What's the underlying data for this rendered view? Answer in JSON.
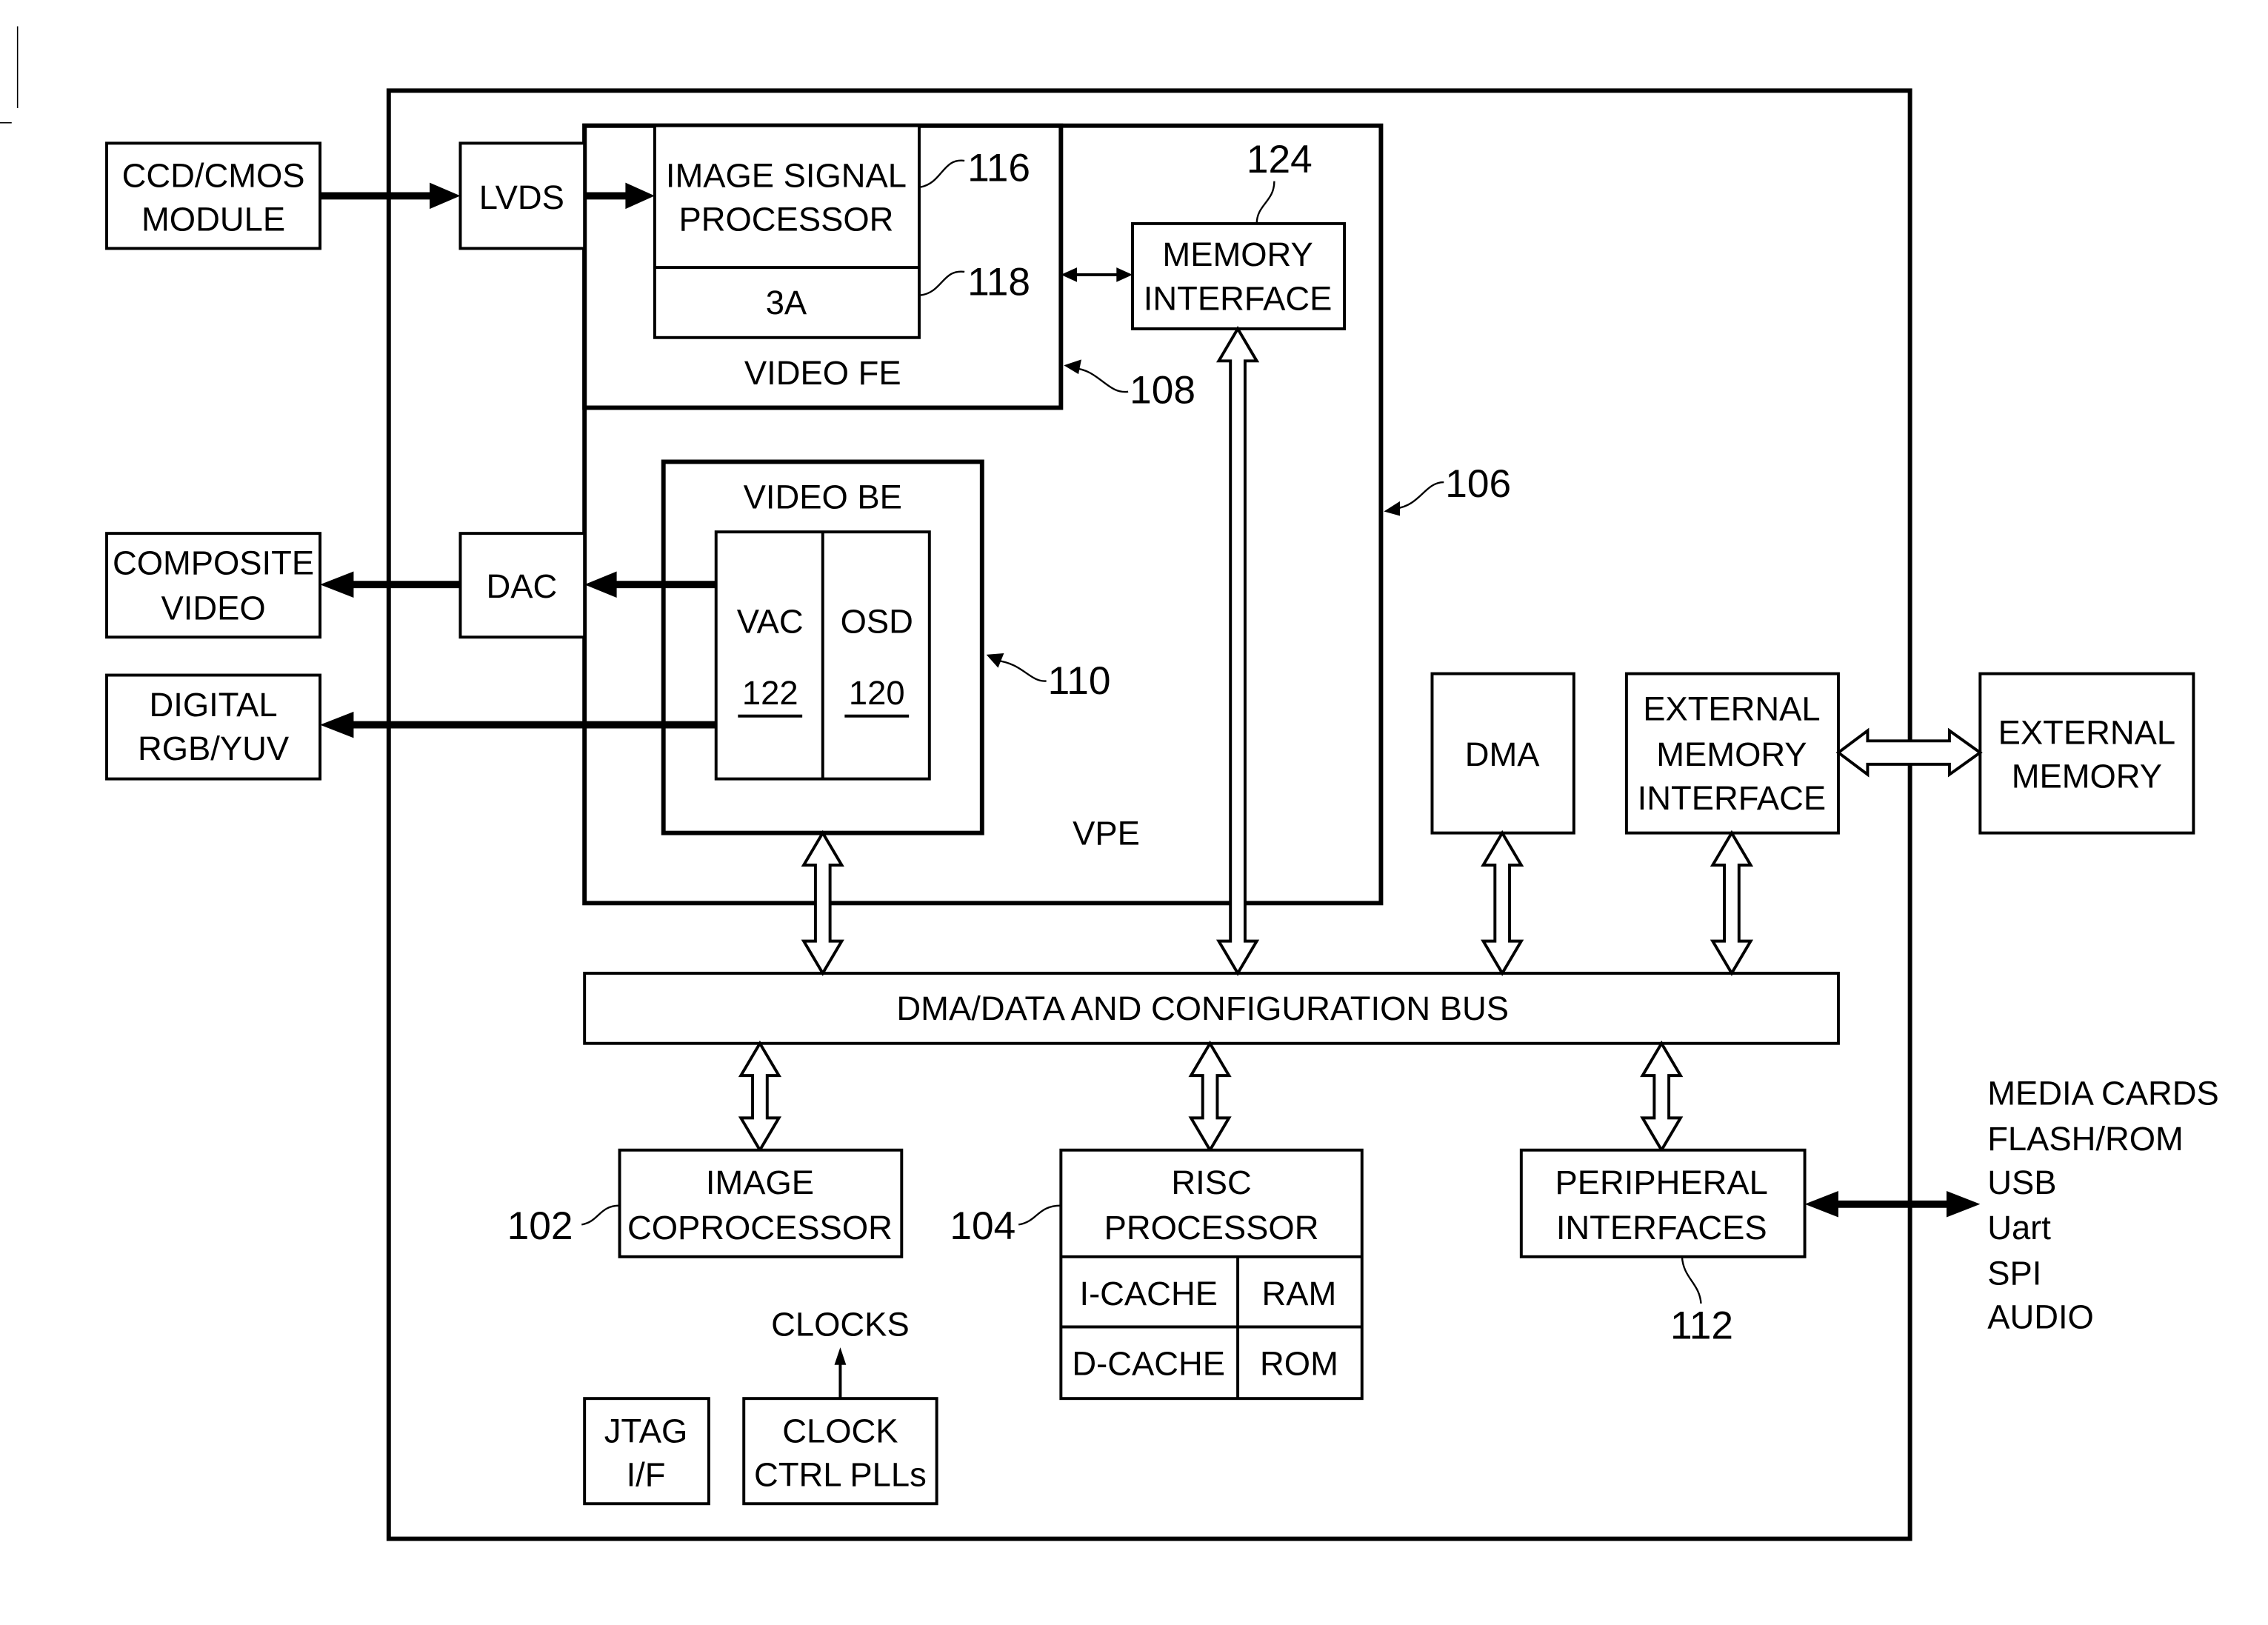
{
  "figure": {
    "external": {
      "ccd_cmos": [
        "CCD/CMOS",
        "MODULE"
      ],
      "composite_video": [
        "COMPOSITE",
        "VIDEO"
      ],
      "digital_rgb": [
        "DIGITAL",
        "RGB/YUV"
      ],
      "external_memory": [
        "EXTERNAL",
        "MEMORY"
      ],
      "media_list": [
        "MEDIA CARDS",
        "FLASH/ROM",
        "USB",
        "Uart",
        "SPI",
        "AUDIO"
      ]
    },
    "soc": {
      "lvds": "LVDS",
      "dac": "DAC",
      "isp": [
        "IMAGE SIGNAL",
        "PROCESSOR"
      ],
      "three_a": "3A",
      "video_fe": "VIDEO FE",
      "memory_interface": [
        "MEMORY",
        "INTERFACE"
      ],
      "video_be": "VIDEO BE",
      "vac": "VAC",
      "vac_ref": "122",
      "osd": "OSD",
      "osd_ref": "120",
      "vpe": "VPE",
      "dma": "DMA",
      "ext_mem_if": [
        "EXTERNAL",
        "MEMORY",
        "INTERFACE"
      ],
      "bus": "DMA/DATA AND CONFIGURATION BUS",
      "image_coprocessor": [
        "IMAGE",
        "COPROCESSOR"
      ],
      "risc": [
        "RISC",
        "PROCESSOR"
      ],
      "icache": "I-CACHE",
      "ram": "RAM",
      "dcache": "D-CACHE",
      "rom": "ROM",
      "peripheral": [
        "PERIPHERAL",
        "INTERFACES"
      ],
      "clocks": "CLOCKS",
      "clock_ctrl": [
        "CLOCK",
        "CTRL PLLs"
      ],
      "jtag": [
        "JTAG",
        "I/F"
      ]
    },
    "refs": {
      "r102": "102",
      "r104": "104",
      "r106": "106",
      "r108": "108",
      "r110": "110",
      "r112": "112",
      "r116": "116",
      "r118": "118",
      "r124": "124"
    }
  }
}
